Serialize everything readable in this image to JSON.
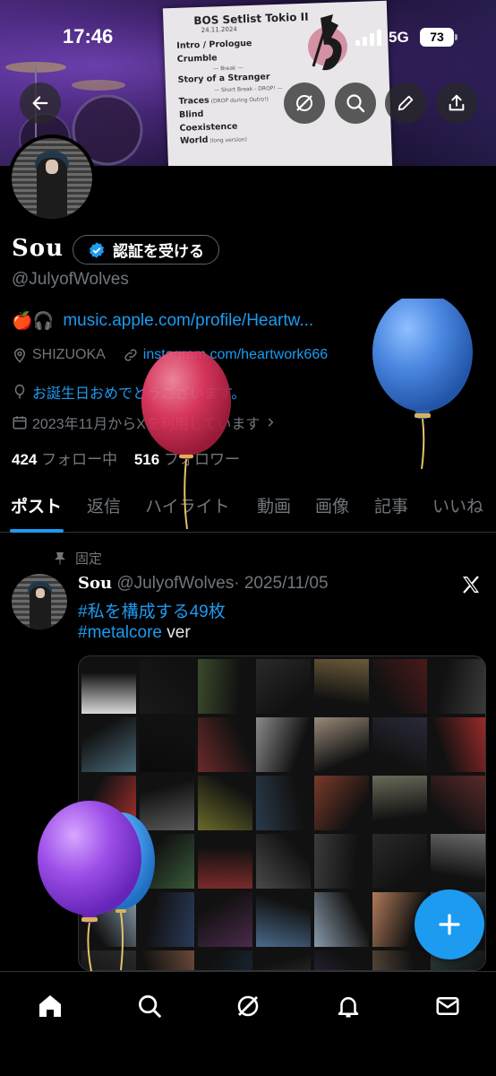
{
  "status_bar": {
    "time": "17:46",
    "network": "5G",
    "battery": "73"
  },
  "banner": {
    "setlist_title": "BOS Setlist Tokio II",
    "setlist_date": "24.11.2024",
    "setlist_lines": [
      {
        "text": "Intro / Prologue",
        "note": ""
      },
      {
        "text": "Crumble",
        "note": ""
      },
      {
        "text": "",
        "note": "— Break —"
      },
      {
        "text": "Story of a Stranger",
        "note": ""
      },
      {
        "text": "",
        "note": "— Short Break - DROP! —"
      },
      {
        "text": "Traces",
        "note": "(DROP during Outro!)"
      },
      {
        "text": "Blind",
        "note": ""
      },
      {
        "text": "Coexistence",
        "note": ""
      },
      {
        "text": "World",
        "note": "(long version)"
      }
    ]
  },
  "profile": {
    "display_name": "Sou",
    "verify_button": "認証を受ける",
    "handle": "@JulyofWolves",
    "bio_emojis": "🍎🎧",
    "bio_link": "music.apple.com/profile/Heartw...",
    "location": "SHIZUOKA",
    "website": "instagram.com/heartwork666",
    "birthday": "お誕生日おめでとうございます。",
    "joined": "2023年11月からXを利用しています",
    "following_count": "424",
    "following_label": "フォロー中",
    "followers_count": "516",
    "followers_label": "フォロワー"
  },
  "tabs": [
    "ポスト",
    "返信",
    "ハイライト",
    "動画",
    "画像",
    "記事",
    "いいね"
  ],
  "post": {
    "pinned_label": "固定",
    "author_name": "Sou",
    "author_handle": "@JulyofWolves",
    "date": "· 2025/11/05",
    "line1_hashtag": "#私を構成する49枚",
    "line2_hashtag": "#metalcore",
    "line2_text": " ver"
  },
  "colors": {
    "accent": "#1d9bf0",
    "muted": "#71767b",
    "background": "#000000"
  },
  "bottom_nav": [
    "home-icon",
    "search-icon",
    "grok-icon",
    "notifications-icon",
    "messages-icon"
  ]
}
